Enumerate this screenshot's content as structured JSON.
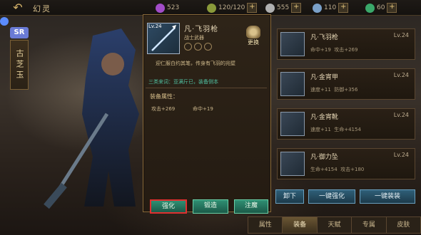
{
  "header": {
    "title": "幻灵",
    "resources": [
      {
        "name": "purple-gem",
        "value": "523",
        "color": "#a24cc8"
      },
      {
        "name": "stamina",
        "value": "120/120",
        "color": "#8a9a3a"
      },
      {
        "name": "silver",
        "value": "555",
        "color": "#b0b0b0"
      },
      {
        "name": "wings",
        "value": "110",
        "color": "#7aa0c8"
      },
      {
        "name": "jade",
        "value": "60",
        "color": "#3aa86a"
      }
    ]
  },
  "left_tab": {
    "badge": "SR",
    "label": "古芝玉"
  },
  "popup": {
    "level": "Lv.24",
    "name": "凡·飞羽枪",
    "type": "战士武器",
    "change_label": "更换",
    "description": "迎仁服白约其笔，传身有飞羽的兆壁",
    "skill": "三类来词：亚满斤已，装备侧本",
    "attr_head": "装备属性：",
    "attr_1": "攻击+269",
    "attr_2": "命中+19",
    "buttons": {
      "enhance": "强化",
      "forge": "锻造",
      "inject": "注魔"
    }
  },
  "list": [
    {
      "name": "凡·飞羽枪",
      "level": "Lv.24",
      "stat_a": "命中+19",
      "stat_b": "攻击+269"
    },
    {
      "name": "凡·金宵甲",
      "level": "Lv.24",
      "stat_a": "速度+11",
      "stat_b": "防御+356"
    },
    {
      "name": "凡·金宵靴",
      "level": "Lv.24",
      "stat_a": "速度+11",
      "stat_b": "生命+4154"
    },
    {
      "name": "凡·御力坠",
      "level": "Lv.24",
      "stat_a": "生命+4154",
      "stat_b": "攻击+180"
    }
  ],
  "actions": {
    "unload": "卸下",
    "one_key_enhance": "一键强化",
    "one_key_equip": "一键装装"
  },
  "bottom_tabs": [
    "属性",
    "装备",
    "天赋",
    "专属",
    "皮肤"
  ]
}
